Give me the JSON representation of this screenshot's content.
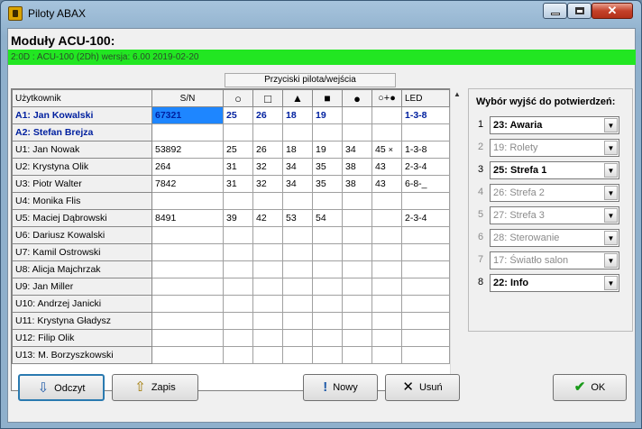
{
  "window": {
    "title": "Piloty ABAX",
    "min": "–",
    "max": "□",
    "close": "✕"
  },
  "module": {
    "title": "Moduły ACU-100:",
    "status": "2:0D :  ACU-100  (2Dh) wersja: 6.00 2019-02-20"
  },
  "grid": {
    "group_header": "Przyciski pilota/wejścia",
    "headers": {
      "user": "Użytkownik",
      "sn": "S/N",
      "b1": "○",
      "b2": "□",
      "b3": "▲",
      "b4": "■",
      "b5": "●",
      "b6": "○+●",
      "led": "LED"
    },
    "rows": [
      {
        "user": "A1: Jan Kowalski",
        "sn": "67321",
        "b1": "25",
        "b2": "26",
        "b3": "18",
        "b4": "19",
        "b5": "",
        "b6": "",
        "led": "1-3-8",
        "admin": true
      },
      {
        "user": "A2: Stefan Brejza",
        "sn": "",
        "b1": "",
        "b2": "",
        "b3": "",
        "b4": "",
        "b5": "",
        "b6": "",
        "led": "",
        "admin": true
      },
      {
        "user": "U1: Jan Nowak",
        "sn": "53892",
        "b1": "25",
        "b2": "26",
        "b3": "18",
        "b4": "19",
        "b5": "34",
        "b6": "45",
        "led": "1-3-8",
        "mark": "×"
      },
      {
        "user": "U2: Krystyna Olik",
        "sn": "264",
        "b1": "31",
        "b2": "32",
        "b3": "34",
        "b4": "35",
        "b5": "38",
        "b6": "43",
        "led": "2-3-4"
      },
      {
        "user": "U3: Piotr Walter",
        "sn": "7842",
        "b1": "31",
        "b2": "32",
        "b3": "34",
        "b4": "35",
        "b5": "38",
        "b6": "43",
        "led": "6-8-_"
      },
      {
        "user": "U4: Monika Flis",
        "sn": "",
        "b1": "",
        "b2": "",
        "b3": "",
        "b4": "",
        "b5": "",
        "b6": "",
        "led": ""
      },
      {
        "user": "U5: Maciej Dąbrowski",
        "sn": "8491",
        "b1": "39",
        "b2": "42",
        "b3": "53",
        "b4": "54",
        "b5": "",
        "b6": "",
        "led": "2-3-4"
      },
      {
        "user": "U6: Dariusz Kowalski",
        "sn": "",
        "b1": "",
        "b2": "",
        "b3": "",
        "b4": "",
        "b5": "",
        "b6": "",
        "led": ""
      },
      {
        "user": "U7: Kamil Ostrowski",
        "sn": "",
        "b1": "",
        "b2": "",
        "b3": "",
        "b4": "",
        "b5": "",
        "b6": "",
        "led": ""
      },
      {
        "user": "U8: Alicja Majchrzak",
        "sn": "",
        "b1": "",
        "b2": "",
        "b3": "",
        "b4": "",
        "b5": "",
        "b6": "",
        "led": ""
      },
      {
        "user": "U9: Jan Miller",
        "sn": "",
        "b1": "",
        "b2": "",
        "b3": "",
        "b4": "",
        "b5": "",
        "b6": "",
        "led": ""
      },
      {
        "user": "U10: Andrzej Janicki",
        "sn": "",
        "b1": "",
        "b2": "",
        "b3": "",
        "b4": "",
        "b5": "",
        "b6": "",
        "led": ""
      },
      {
        "user": "U11: Krystyna Gładysz",
        "sn": "",
        "b1": "",
        "b2": "",
        "b3": "",
        "b4": "",
        "b5": "",
        "b6": "",
        "led": ""
      },
      {
        "user": "U12: Filip Olik",
        "sn": "",
        "b1": "",
        "b2": "",
        "b3": "",
        "b4": "",
        "b5": "",
        "b6": "",
        "led": ""
      },
      {
        "user": "U13: M. Borzyszkowski",
        "sn": "",
        "b1": "",
        "b2": "",
        "b3": "",
        "b4": "",
        "b5": "",
        "b6": "",
        "led": ""
      }
    ]
  },
  "panel": {
    "title": "Wybór wyjść do potwierdzeń:",
    "outputs": [
      {
        "num": "1",
        "value": "23: Awaria",
        "active": true
      },
      {
        "num": "2",
        "value": "19: Rolety",
        "active": false
      },
      {
        "num": "3",
        "value": "25: Strefa 1",
        "active": true
      },
      {
        "num": "4",
        "value": "26: Strefa 2",
        "active": false
      },
      {
        "num": "5",
        "value": "27: Strefa 3",
        "active": false
      },
      {
        "num": "6",
        "value": "28: Sterowanie",
        "active": false
      },
      {
        "num": "7",
        "value": "17: Światło salon",
        "active": false
      },
      {
        "num": "8",
        "value": "22: Info",
        "active": true
      }
    ]
  },
  "buttons": {
    "read": "Odczyt",
    "write": "Zapis",
    "new": "Nowy",
    "delete": "Usuń",
    "ok": "OK"
  },
  "icons": {
    "read": "read-device-icon",
    "write": "write-device-icon",
    "new": "exclamation-icon",
    "delete": "x-icon",
    "ok": "checkmark-icon"
  },
  "colors": {
    "status": "#22e622",
    "selected": "#1e86ff",
    "admin": "#00209f",
    "ok_check": "#1a9a1a"
  }
}
